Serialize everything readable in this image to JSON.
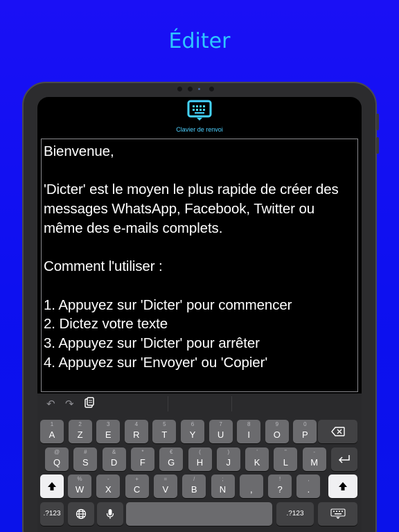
{
  "headline": "Éditer",
  "app": {
    "keyboard_caption": "Clavier de renvoi",
    "editor_text": "Bienvenue,\n\n'Dicter' est le moyen le plus rapide de créer des messages WhatsApp, Facebook, Twitter ou même des e-mails complets.\n\nComment l'utiliser :\n\n1. Appuyez sur 'Dicter' pour commencer\n2. Dictez votre texte\n3. Appuyez sur 'Dicter' pour arrêter\n4. Appuyez sur 'Envoyer' ou 'Copier'"
  },
  "shortcut_bar": {
    "undo_icon": "undo-icon",
    "redo_icon": "redo-icon",
    "paste_icon": "paste-icon"
  },
  "keyboard": {
    "row1": [
      {
        "main": "A",
        "alt": "1"
      },
      {
        "main": "Z",
        "alt": "2"
      },
      {
        "main": "E",
        "alt": "3"
      },
      {
        "main": "R",
        "alt": "4"
      },
      {
        "main": "T",
        "alt": "5"
      },
      {
        "main": "Y",
        "alt": "6"
      },
      {
        "main": "U",
        "alt": "7"
      },
      {
        "main": "I",
        "alt": "8"
      },
      {
        "main": "O",
        "alt": "9"
      },
      {
        "main": "P",
        "alt": "0"
      }
    ],
    "row2": [
      {
        "main": "Q",
        "alt": "@"
      },
      {
        "main": "S",
        "alt": "#"
      },
      {
        "main": "D",
        "alt": "&"
      },
      {
        "main": "F",
        "alt": "*"
      },
      {
        "main": "G",
        "alt": "€"
      },
      {
        "main": "H",
        "alt": "("
      },
      {
        "main": "J",
        "alt": ")"
      },
      {
        "main": "K",
        "alt": "'"
      },
      {
        "main": "L",
        "alt": "\""
      },
      {
        "main": "M",
        "alt": "-"
      }
    ],
    "row3": [
      {
        "main": "W",
        "alt": "%"
      },
      {
        "main": "X",
        "alt": "-"
      },
      {
        "main": "C",
        "alt": "+"
      },
      {
        "main": "V",
        "alt": "="
      },
      {
        "main": "B",
        "alt": "/"
      },
      {
        "main": "N",
        "alt": ";"
      },
      {
        "main": ",",
        "alt": ""
      },
      {
        "main": "?",
        "alt": "!"
      },
      {
        "main": ".",
        "alt": ","
      }
    ],
    "numbers_label": ".?123",
    "icons": {
      "backspace": "backspace-icon",
      "return": "return-icon",
      "shift": "shift-icon",
      "globe": "globe-icon",
      "mic": "microphone-icon",
      "dismiss": "keyboard-dismiss-icon"
    }
  }
}
